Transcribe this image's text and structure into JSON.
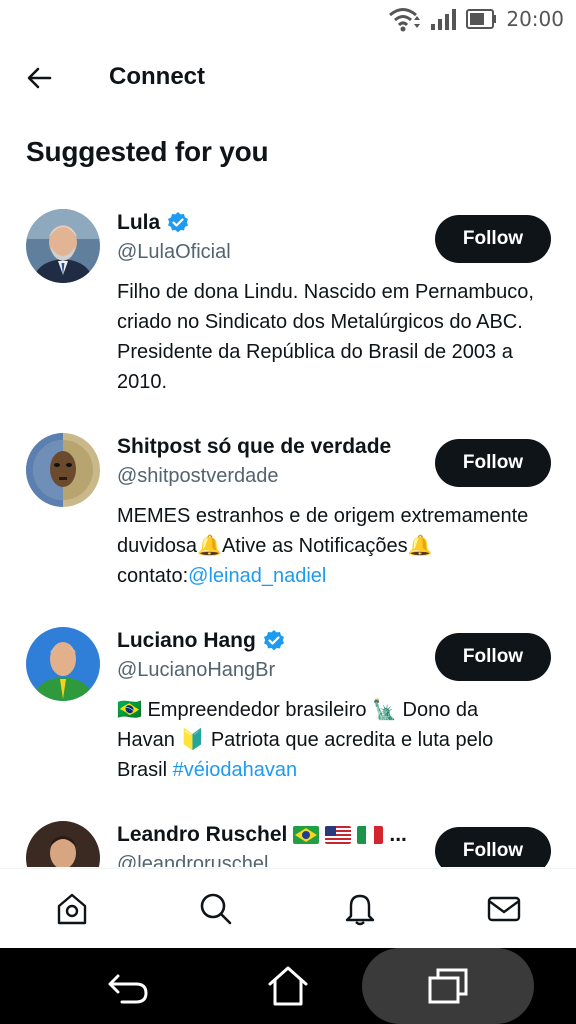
{
  "status_bar": {
    "time": "20:00",
    "icons": [
      "wifi-icon",
      "signal-icon",
      "battery-icon"
    ]
  },
  "header": {
    "title": "Connect",
    "back_icon": "arrow-left-icon"
  },
  "section_title": "Suggested for you",
  "follow_label": "Follow",
  "users": [
    {
      "name": "Lula",
      "verified": true,
      "handle": "@LulaOficial",
      "bio": "Filho de dona Lindu. Nascido em Pernambuco, criado no Sindicato dos Metalúrgicos do ABC. Presidente da República do Brasil de 2003 a 2010."
    },
    {
      "name": "Shitpost só que de verdade",
      "verified": false,
      "handle": "@shitpostverdade",
      "bio_part1": "MEMES estranhos e de origem extremamente duvidosa",
      "bio_emoji1": "🔔",
      "bio_part2": "Ative as Notificações",
      "bio_emoji2": "🔔",
      "bio_part3": "contato:",
      "bio_link": "@leinad_nadiel"
    },
    {
      "name": "Luciano Hang",
      "verified": true,
      "handle": "@LucianoHangBr",
      "bio_emoji1": "🇧🇷",
      "bio_part1": "Empreendedor brasileiro",
      "bio_emoji2": "🗽",
      "bio_part2": "Dono da Havan",
      "bio_emoji3": "🔰",
      "bio_part3": "Patriota que acredita e luta pelo Brasil",
      "bio_link": "#véiodahavan"
    },
    {
      "name": "Leandro Ruschel",
      "flags": [
        "flag-brazil-icon",
        "flag-usa-icon",
        "flag-italy-icon"
      ],
      "ellipsis": "...",
      "handle": "@leandroruschel"
    }
  ],
  "bottom_nav": [
    "home-icon",
    "search-icon",
    "notifications-icon",
    "messages-icon"
  ],
  "system_nav": [
    "back-icon",
    "home-icon",
    "recents-icon"
  ],
  "colors": {
    "text": "#0f1419",
    "secondary": "#536471",
    "link": "#1d9bf0",
    "verified": "#1d9bf0",
    "button": "#0f1419"
  }
}
